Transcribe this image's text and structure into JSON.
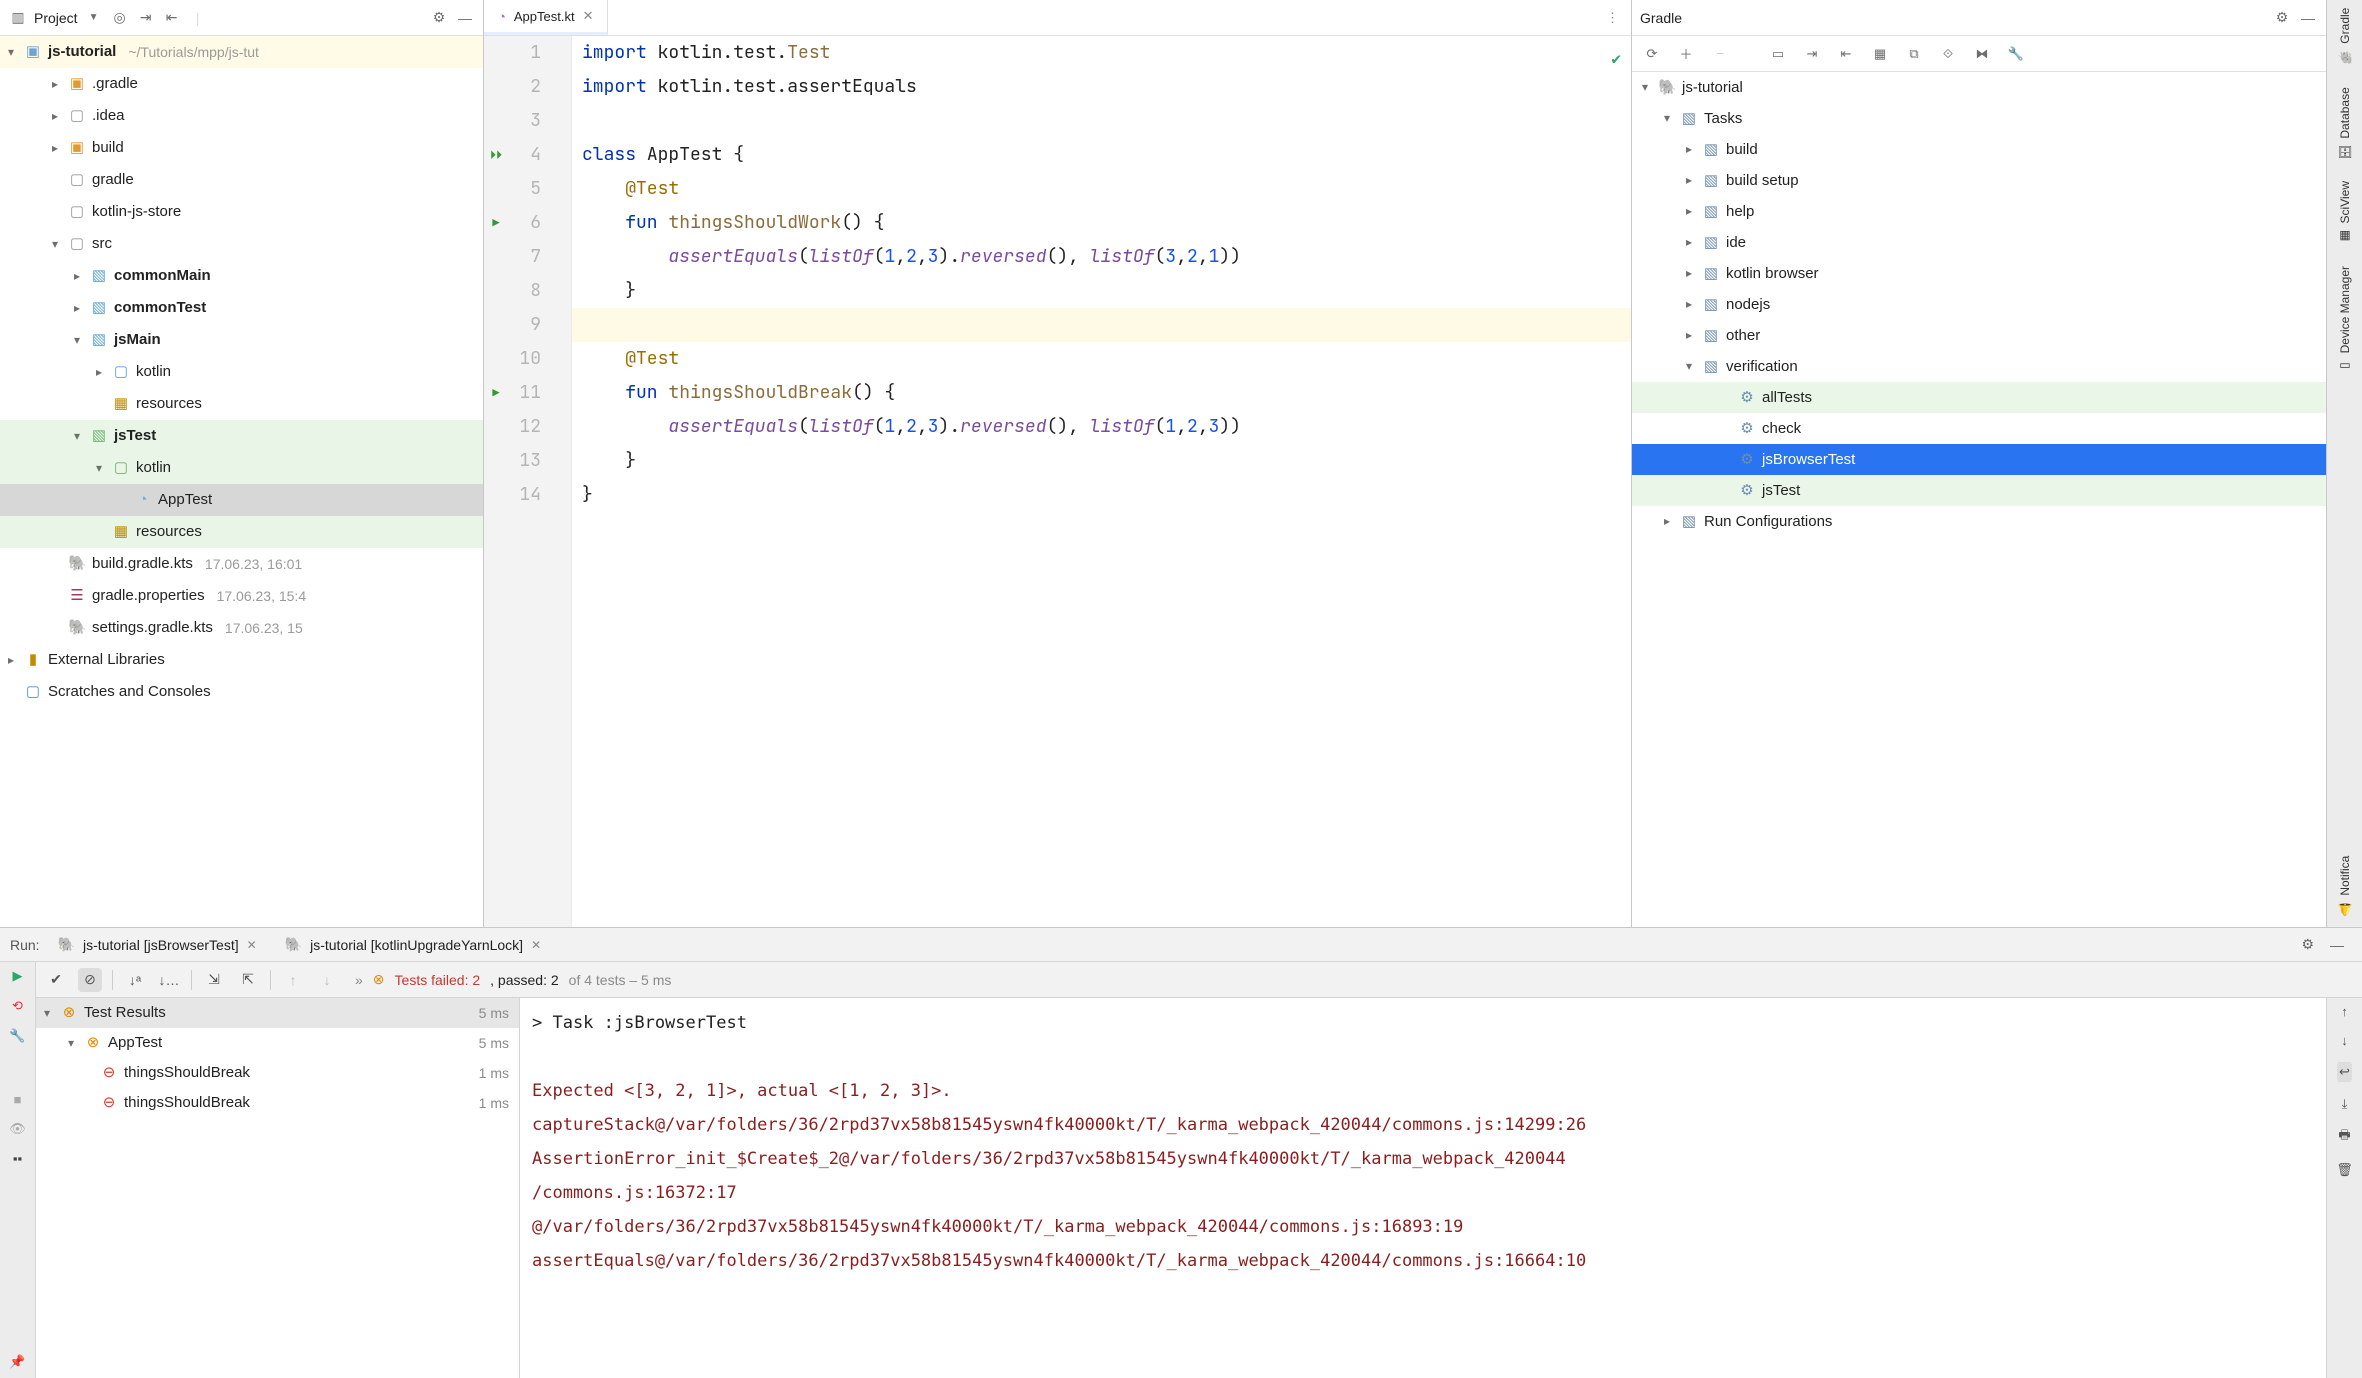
{
  "project_panel": {
    "title": "Project",
    "root": {
      "name": "js-tutorial",
      "path": "~/Tutorials/mpp/js-tut"
    },
    "items": [
      {
        "label": ".gradle",
        "indent": 2,
        "arrow": "right",
        "icon": "folder-orange"
      },
      {
        "label": ".idea",
        "indent": 2,
        "arrow": "right",
        "icon": "folder-gray"
      },
      {
        "label": "build",
        "indent": 2,
        "arrow": "right",
        "icon": "folder-orange"
      },
      {
        "label": "gradle",
        "indent": 2,
        "arrow": "none",
        "icon": "folder-gray"
      },
      {
        "label": "kotlin-js-store",
        "indent": 2,
        "arrow": "none",
        "icon": "folder-gray"
      },
      {
        "label": "src",
        "indent": 2,
        "arrow": "down",
        "icon": "folder-gray"
      },
      {
        "label": "commonMain",
        "indent": 3,
        "arrow": "right",
        "icon": "mod-blue",
        "bold": true
      },
      {
        "label": "commonTest",
        "indent": 3,
        "arrow": "right",
        "icon": "mod-blue",
        "bold": true
      },
      {
        "label": "jsMain",
        "indent": 3,
        "arrow": "down",
        "icon": "mod-blue",
        "bold": true
      },
      {
        "label": "kotlin",
        "indent": 4,
        "arrow": "right",
        "icon": "folder-blue"
      },
      {
        "label": "resources",
        "indent": 4,
        "arrow": "none",
        "icon": "res"
      },
      {
        "label": "jsTest",
        "indent": 3,
        "arrow": "down",
        "icon": "mod-green",
        "bold": true,
        "hl": "green"
      },
      {
        "label": "kotlin",
        "indent": 4,
        "arrow": "down",
        "icon": "folder-green",
        "hl": "green"
      },
      {
        "label": "AppTest",
        "indent": 5,
        "arrow": "none",
        "icon": "kfile",
        "hl": "gray"
      },
      {
        "label": "resources",
        "indent": 4,
        "arrow": "none",
        "icon": "res",
        "hl": "green"
      },
      {
        "label": "build.gradle.kts",
        "indent": 2,
        "arrow": "none",
        "icon": "gradle",
        "side": "17.06.23, 16:01"
      },
      {
        "label": "gradle.properties",
        "indent": 2,
        "arrow": "none",
        "icon": "props",
        "side": "17.06.23, 15:4"
      },
      {
        "label": "settings.gradle.kts",
        "indent": 2,
        "arrow": "none",
        "icon": "gradle",
        "side": "17.06.23, 15"
      }
    ],
    "external_libs": "External Libraries",
    "scratches": "Scratches and Consoles"
  },
  "editor": {
    "tab_name": "AppTest.kt",
    "lines_count": 14,
    "gutter_run": {
      "4": "double",
      "6": "single",
      "11": "single"
    }
  },
  "gradle": {
    "title": "Gradle",
    "root": "js-tutorial",
    "tasks_label": "Tasks",
    "groups": [
      {
        "label": "build"
      },
      {
        "label": "build setup"
      },
      {
        "label": "help"
      },
      {
        "label": "ide"
      },
      {
        "label": "kotlin browser"
      },
      {
        "label": "nodejs"
      },
      {
        "label": "other"
      }
    ],
    "verification_label": "verification",
    "verification_tasks": [
      {
        "name": "allTests",
        "hl": "green"
      },
      {
        "name": "check"
      },
      {
        "name": "jsBrowserTest",
        "hl": "blue"
      },
      {
        "name": "jsTest",
        "hl": "green"
      }
    ],
    "run_conf": "Run Configurations"
  },
  "right_rail": {
    "gradle": "Gradle",
    "database": "Database",
    "sciview": "SciView",
    "device_manager": "Device Manager",
    "notifica": "Notifica"
  },
  "run": {
    "label": "Run:",
    "tab1": "js-tutorial [jsBrowserTest]",
    "tab2": "js-tutorial [kotlinUpgradeYarnLock]",
    "summary": {
      "fail_prefix": "Tests failed: ",
      "fail_n": "2",
      "pass_prefix": ", passed: ",
      "pass_n": "2",
      "suffix": " of 4 tests – 5 ms"
    },
    "tree": {
      "root": "Test Results",
      "root_dur": "5 ms",
      "class": "AppTest",
      "class_dur": "5 ms",
      "t1": "thingsShouldBreak",
      "t1_dur": "1 ms",
      "t2": "thingsShouldBreak",
      "t2_dur": "1 ms"
    },
    "console": {
      "task": "> Task :jsBrowserTest",
      "err1": "Expected <[3, 2, 1]>, actual <[1, 2, 3]>.",
      "err2": "captureStack@/var/folders/36/2rpd37vx58b81545yswn4fk40000kt/T/_karma_webpack_420044/commons.js:14299:26",
      "err3": "AssertionError_init_$Create$_2@/var/folders/36/2rpd37vx58b81545yswn4fk40000kt/T/_karma_webpack_420044",
      "err3b": " /commons.js:16372:17",
      "err4": "@/var/folders/36/2rpd37vx58b81545yswn4fk40000kt/T/_karma_webpack_420044/commons.js:16893:19",
      "err5": "assertEquals@/var/folders/36/2rpd37vx58b81545yswn4fk40000kt/T/_karma_webpack_420044/commons.js:16664:10"
    }
  }
}
